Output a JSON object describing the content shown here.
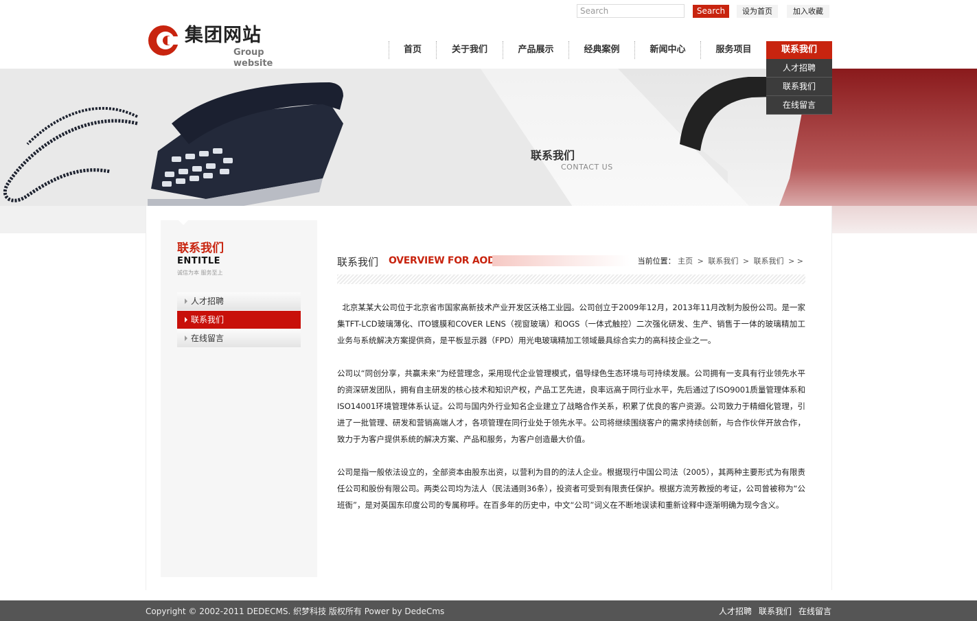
{
  "header": {
    "search_placeholder": "Search",
    "search_button": "Search",
    "set_homepage": "设为首页",
    "add_favorite": "加入收藏",
    "logo_cn": "集团网站",
    "logo_en": "Group website"
  },
  "nav": {
    "items": [
      {
        "label": "首页"
      },
      {
        "label": "关于我们"
      },
      {
        "label": "产品展示"
      },
      {
        "label": "经典案例"
      },
      {
        "label": "新闻中心"
      },
      {
        "label": "服务项目"
      },
      {
        "label": "联系我们",
        "active": true
      }
    ],
    "dropdown": [
      "人才招聘",
      "联系我们",
      "在线留言"
    ]
  },
  "banner": {
    "title": "联系我们",
    "subtitle": "CONTACT US"
  },
  "sidebar": {
    "title": "联系我们",
    "en_title": "ENTITLE",
    "slogan": "诚信为本 服务至上",
    "menu": [
      {
        "label": "人才招聘",
        "active": false
      },
      {
        "label": "联系我们",
        "active": true
      },
      {
        "label": "在线留言",
        "active": false
      }
    ]
  },
  "article": {
    "heading_cn": "联系我们",
    "heading_en": "OVERVIEW FOR AODE",
    "breadcrumb": {
      "label": "当前位置：",
      "items": [
        "主页",
        "联系我们",
        "联系我们"
      ],
      "trailing": "> >"
    },
    "paragraphs": [
      "  北京某某大公司位于北京省市国家高新技术产业开发区沃格工业园。公司创立于2009年12月，2013年11月改制为股份公司。是一家集TFT-LCD玻璃薄化、ITO镀膜和COVER LENS（视窗玻璃）和OGS（一体式触控）二次强化研发、生产、销售于一体的玻璃精加工业务与系统解决方案提供商，是平板显示器（FPD）用光电玻璃精加工领域最具综合实力的高科技企业之一。",
      "公司以“同创分享，共赢未来”为经营理念，采用现代企业管理模式，倡导绿色生态环境与可持续发展。公司拥有一支具有行业领先水平的资深研发团队，拥有自主研发的核心技术和知识产权，产品工艺先进，良率远高于同行业水平，先后通过了ISO9001质量管理体系和ISO14001环境管理体系认证。公司与国内外行业知名企业建立了战略合作关系，积累了优良的客户资源。公司致力于精细化管理，引进了一批管理、研发和营销高端人才，各项管理在同行业处于领先水平。公司将继续围绕客户的需求持续创新，与合作伙伴开放合作，致力于为客户提供系统的解决方案、产品和服务，为客户创造最大价值。",
      "公司是指一般依法设立的，全部资本由股东出资，以营利为目的的法人企业。根据现行中国公司法（2005），其两种主要形式为有限责任公司和股份有限公司。两类公司均为法人（民法通则36条），投资者可受到有限责任保护。根据方流芳教授的考证，公司曾被称为“公班衙”，是对英国东印度公司的专属称呼。在百多年的历史中，中文“公司”词义在不断地误读和重新诠释中逐渐明确为现今含义。"
    ]
  },
  "footer": {
    "copyright": "Copyright © 2002-2011 DEDECMS. 织梦科技 版权所有 Power by DedeCms",
    "links": [
      "人才招聘",
      "联系我们",
      "在线留言"
    ]
  },
  "colors": {
    "brand_red": "#c8240f",
    "footer_bg": "#555555",
    "dropdown_bg": "#3c3c3c"
  }
}
